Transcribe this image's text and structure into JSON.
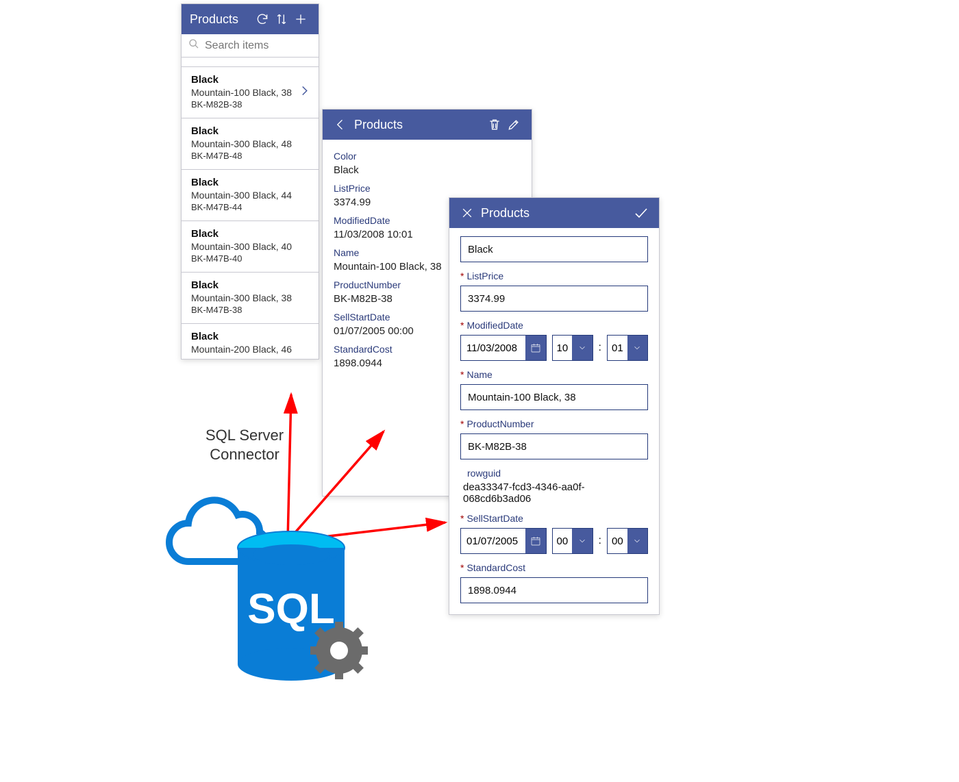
{
  "annotation": {
    "text1": "SQL Server",
    "text2": "Connector"
  },
  "list": {
    "title": "Products",
    "search_placeholder": "Search items",
    "items": [
      {
        "color": "Black",
        "name": "Mountain-100 Black, 38",
        "sku": "BK-M82B-38",
        "selected": true
      },
      {
        "color": "Black",
        "name": "Mountain-300 Black, 48",
        "sku": "BK-M47B-48",
        "selected": false
      },
      {
        "color": "Black",
        "name": "Mountain-300 Black, 44",
        "sku": "BK-M47B-44",
        "selected": false
      },
      {
        "color": "Black",
        "name": "Mountain-300 Black, 40",
        "sku": "BK-M47B-40",
        "selected": false
      },
      {
        "color": "Black",
        "name": "Mountain-300 Black, 38",
        "sku": "BK-M47B-38",
        "selected": false
      },
      {
        "color": "Black",
        "name": "Mountain-200 Black, 46",
        "sku": "",
        "selected": false
      }
    ]
  },
  "detail": {
    "title": "Products",
    "fields": {
      "color_label": "Color",
      "color_val": "Black",
      "listprice_label": "ListPrice",
      "listprice_val": "3374.99",
      "moddate_label": "ModifiedDate",
      "moddate_val": "11/03/2008 10:01",
      "name_label": "Name",
      "name_val": "Mountain-100 Black, 38",
      "prodnum_label": "ProductNumber",
      "prodnum_val": "BK-M82B-38",
      "sellstart_label": "SellStartDate",
      "sellstart_val": "01/07/2005 00:00",
      "stdcost_label": "StandardCost",
      "stdcost_val": "1898.0944"
    }
  },
  "edit": {
    "title": "Products",
    "color_val": "Black",
    "listprice_label": "ListPrice",
    "listprice_val": "3374.99",
    "moddate_label": "ModifiedDate",
    "moddate_date": "11/03/2008",
    "moddate_hh": "10",
    "moddate_mm": "01",
    "name_label": "Name",
    "name_val": "Mountain-100 Black, 38",
    "prodnum_label": "ProductNumber",
    "prodnum_val": "BK-M82B-38",
    "rowguid_label": "rowguid",
    "rowguid_val": "dea33347-fcd3-4346-aa0f-068cd6b3ad06",
    "sellstart_label": "SellStartDate",
    "sellstart_date": "01/07/2005",
    "sellstart_hh": "00",
    "sellstart_mm": "00",
    "stdcost_label": "StandardCost",
    "stdcost_val": "1898.0944"
  }
}
